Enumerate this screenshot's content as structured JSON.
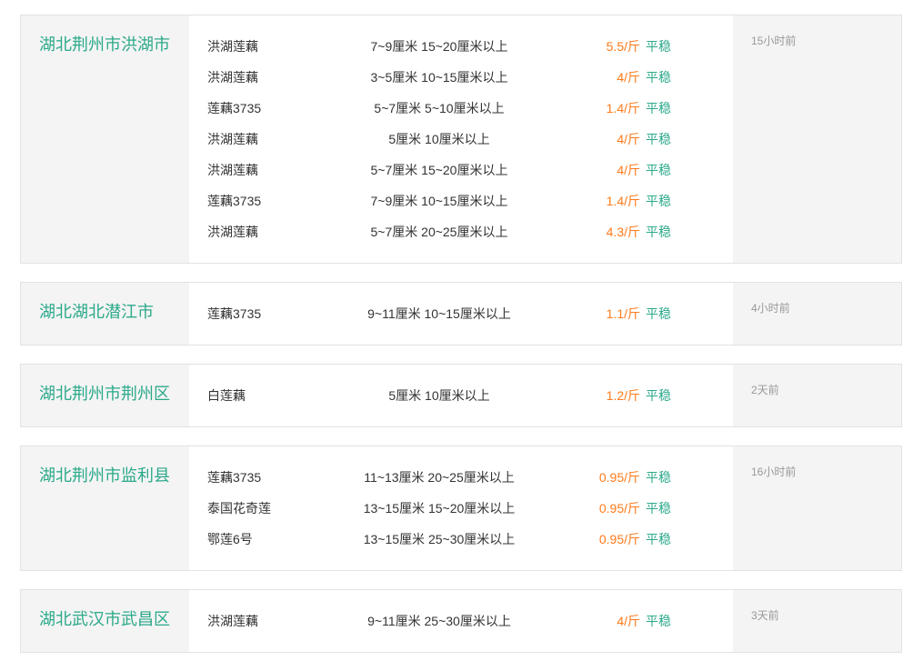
{
  "markets": [
    {
      "location": "湖北荆州市洪湖市",
      "time": "15小时前",
      "items": [
        {
          "name": "洪湖莲藕",
          "spec": "7~9厘米 15~20厘米以上",
          "price": "5.5/斤",
          "trend": "平稳"
        },
        {
          "name": "洪湖莲藕",
          "spec": "3~5厘米 10~15厘米以上",
          "price": "4/斤",
          "trend": "平稳"
        },
        {
          "name": "莲藕3735",
          "spec": "5~7厘米 5~10厘米以上",
          "price": "1.4/斤",
          "trend": "平稳"
        },
        {
          "name": "洪湖莲藕",
          "spec": "5厘米 10厘米以上",
          "price": "4/斤",
          "trend": "平稳"
        },
        {
          "name": "洪湖莲藕",
          "spec": "5~7厘米 15~20厘米以上",
          "price": "4/斤",
          "trend": "平稳"
        },
        {
          "name": "莲藕3735",
          "spec": "7~9厘米 10~15厘米以上",
          "price": "1.4/斤",
          "trend": "平稳"
        },
        {
          "name": "洪湖莲藕",
          "spec": "5~7厘米 20~25厘米以上",
          "price": "4.3/斤",
          "trend": "平稳"
        }
      ]
    },
    {
      "location": "湖北湖北潜江市",
      "time": "4小时前",
      "items": [
        {
          "name": "莲藕3735",
          "spec": "9~11厘米 10~15厘米以上",
          "price": "1.1/斤",
          "trend": "平稳"
        }
      ]
    },
    {
      "location": "湖北荆州市荆州区",
      "time": "2天前",
      "items": [
        {
          "name": "白莲藕",
          "spec": "5厘米 10厘米以上",
          "price": "1.2/斤",
          "trend": "平稳"
        }
      ]
    },
    {
      "location": "湖北荆州市监利县",
      "time": "16小时前",
      "items": [
        {
          "name": "莲藕3735",
          "spec": "11~13厘米 20~25厘米以上",
          "price": "0.95/斤",
          "trend": "平稳"
        },
        {
          "name": "泰国花奇莲",
          "spec": "13~15厘米 15~20厘米以上",
          "price": "0.95/斤",
          "trend": "平稳"
        },
        {
          "name": "鄂莲6号",
          "spec": "13~15厘米 25~30厘米以上",
          "price": "0.95/斤",
          "trend": "平稳"
        }
      ]
    },
    {
      "location": "湖北武汉市武昌区",
      "time": "3天前",
      "items": [
        {
          "name": "洪湖莲藕",
          "spec": "9~11厘米 25~30厘米以上",
          "price": "4/斤",
          "trend": "平稳"
        }
      ]
    }
  ],
  "colors": {
    "location": "#2ba98a",
    "price": "#ff7a1a",
    "trend": "#2ba98a",
    "time": "#999999"
  }
}
